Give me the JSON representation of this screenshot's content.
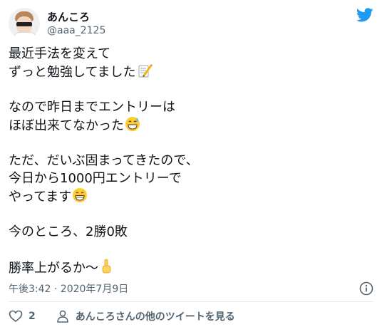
{
  "user": {
    "display_name": "あんころ",
    "handle": "@aaa_2125"
  },
  "tweet": {
    "lines": [
      "最近手法を変えて",
      "ずっと勉強してました",
      "",
      "なので昨日までエントリーは",
      "ほぼ出来てなかった",
      "",
      "ただ、だいぶ固まってきたので、",
      "今日から1000円エントリーで",
      "やってます",
      "",
      "今のところ、2勝0敗",
      "",
      "勝率上がるか〜"
    ],
    "emojis": {
      "memo": "memo-icon",
      "sweat_smile": "grinning-sweat-icon",
      "grin": "beaming-face-icon",
      "point_up": "point-up-icon"
    }
  },
  "meta": {
    "timestamp": "午後3:42 · 2020年7月9日"
  },
  "actions": {
    "like_count": "2",
    "more_link": "あんころさんの他のツイートを見る"
  },
  "colors": {
    "twitter_blue": "#1d9bf0",
    "text_primary": "#0f1419",
    "text_secondary": "#536471"
  }
}
